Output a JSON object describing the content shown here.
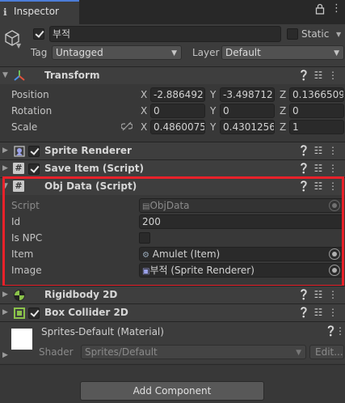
{
  "tab": {
    "title": "Inspector",
    "info_icon": "info-icon",
    "lock_icon": "lock-icon",
    "menu_icon": "kebab-menu-icon"
  },
  "gameobject": {
    "name": "부적",
    "active": true,
    "static_label": "Static",
    "static_checked": false,
    "tag_label": "Tag",
    "tag_value": "Untagged",
    "layer_label": "Layer",
    "layer_value": "Default"
  },
  "transform": {
    "title": "Transform",
    "position": {
      "label": "Position",
      "x": "-2.886492",
      "y": "-3.498712",
      "z": "0.1366509"
    },
    "rotation": {
      "label": "Rotation",
      "x": "0",
      "y": "0",
      "z": "0"
    },
    "scale": {
      "label": "Scale",
      "x": "0.4860075",
      "y": "0.4301256",
      "z": "1"
    },
    "axes": {
      "x": "X",
      "y": "Y",
      "z": "Z"
    }
  },
  "sprite_renderer": {
    "title": "Sprite Renderer",
    "enabled": true
  },
  "save_item": {
    "title": "Save Item (Script)",
    "enabled": true
  },
  "obj_data": {
    "title": "Obj Data (Script)",
    "script_label": "Script",
    "script_value": "ObjData",
    "id_label": "Id",
    "id_value": "200",
    "is_npc_label": "Is NPC",
    "is_npc_checked": false,
    "item_label": "Item",
    "item_value": "Amulet (Item)",
    "image_label": "Image",
    "image_value": "부적 (Sprite Renderer)"
  },
  "rigidbody": {
    "title": "Rigidbody 2D"
  },
  "box_collider": {
    "title": "Box Collider 2D",
    "enabled": true
  },
  "material": {
    "title": "Sprites-Default (Material)",
    "shader_label": "Shader",
    "shader_value": "Sprites/Default",
    "edit_label": "Edit..."
  },
  "add_component": {
    "label": "Add Component"
  },
  "colors": {
    "highlight": "#e8212a",
    "background": "#383838",
    "header": "#3e3e3e",
    "field": "#2a2a2a"
  }
}
